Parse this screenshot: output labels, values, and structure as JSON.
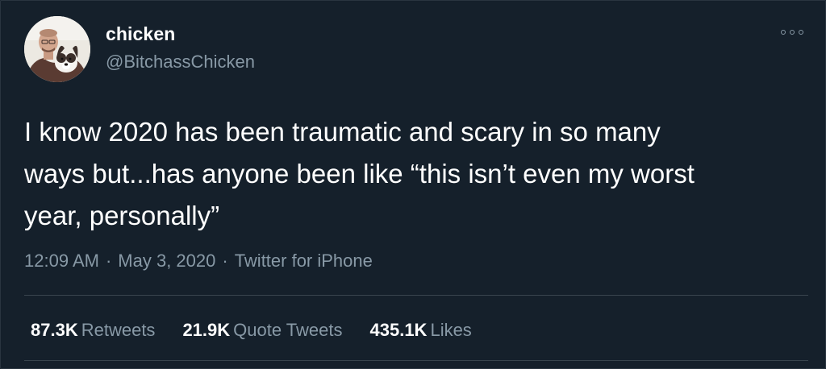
{
  "tweet": {
    "display_name": "chicken",
    "handle": "@BitchassChicken",
    "text_lines": [
      "I know 2020 has been traumatic and scary in so many",
      "ways but...has anyone been like “this isn’t even my worst",
      "year, personally”"
    ],
    "time": "12:09 AM",
    "date": "May 3, 2020",
    "source": "Twitter for iPhone",
    "separator": "·",
    "stats": [
      {
        "count": "87.3K",
        "label": "Retweets"
      },
      {
        "count": "21.9K",
        "label": "Quote Tweets"
      },
      {
        "count": "435.1K",
        "label": "Likes"
      }
    ]
  },
  "icons": {
    "avatar": "profile-photo-man-with-dog",
    "more": "more-options-icon"
  },
  "colors": {
    "background": "#15202b",
    "primary_text": "#ffffff",
    "secondary_text": "#8899a6",
    "divider": "#38444d"
  }
}
